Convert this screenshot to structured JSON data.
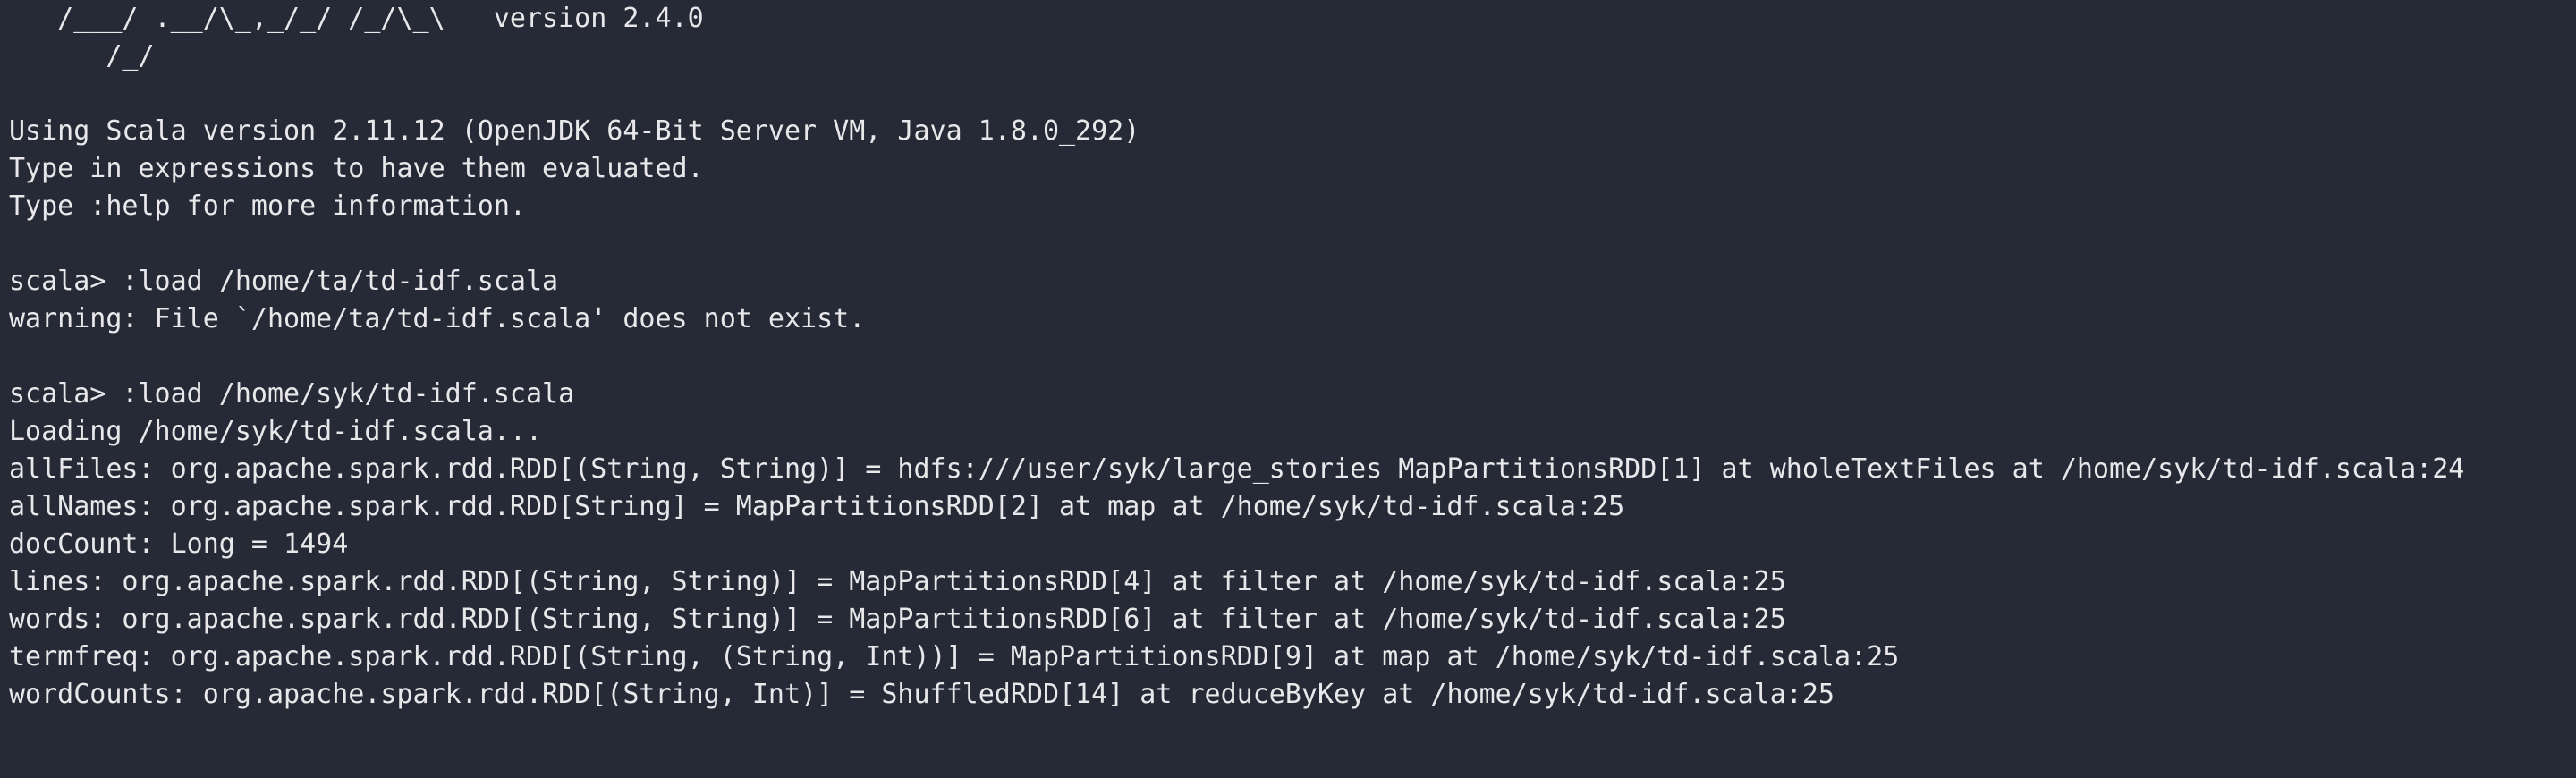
{
  "terminal": {
    "lines": [
      "   /___/ .__/\\_,_/_/ /_/\\_\\   version 2.4.0",
      "      /_/",
      "",
      "Using Scala version 2.11.12 (OpenJDK 64-Bit Server VM, Java 1.8.0_292)",
      "Type in expressions to have them evaluated.",
      "Type :help for more information.",
      "",
      "scala> :load /home/ta/td-idf.scala",
      "warning: File `/home/ta/td-idf.scala' does not exist.",
      "",
      "scala> :load /home/syk/td-idf.scala",
      "Loading /home/syk/td-idf.scala...",
      "allFiles: org.apache.spark.rdd.RDD[(String, String)] = hdfs:///user/syk/large_stories MapPartitionsRDD[1] at wholeTextFiles at /home/syk/td-idf.scala:24",
      "allNames: org.apache.spark.rdd.RDD[String] = MapPartitionsRDD[2] at map at /home/syk/td-idf.scala:25",
      "docCount: Long = 1494",
      "lines: org.apache.spark.rdd.RDD[(String, String)] = MapPartitionsRDD[4] at filter at /home/syk/td-idf.scala:25",
      "words: org.apache.spark.rdd.RDD[(String, String)] = MapPartitionsRDD[6] at filter at /home/syk/td-idf.scala:25",
      "termfreq: org.apache.spark.rdd.RDD[(String, (String, Int))] = MapPartitionsRDD[9] at map at /home/syk/td-idf.scala:25",
      "wordCounts: org.apache.spark.rdd.RDD[(String, Int)] = ShuffledRDD[14] at reduceByKey at /home/syk/td-idf.scala:25"
    ]
  },
  "colors": {
    "background": "#262a36",
    "foreground": "#e8e8ea",
    "cursor": "#c9c9cc"
  }
}
